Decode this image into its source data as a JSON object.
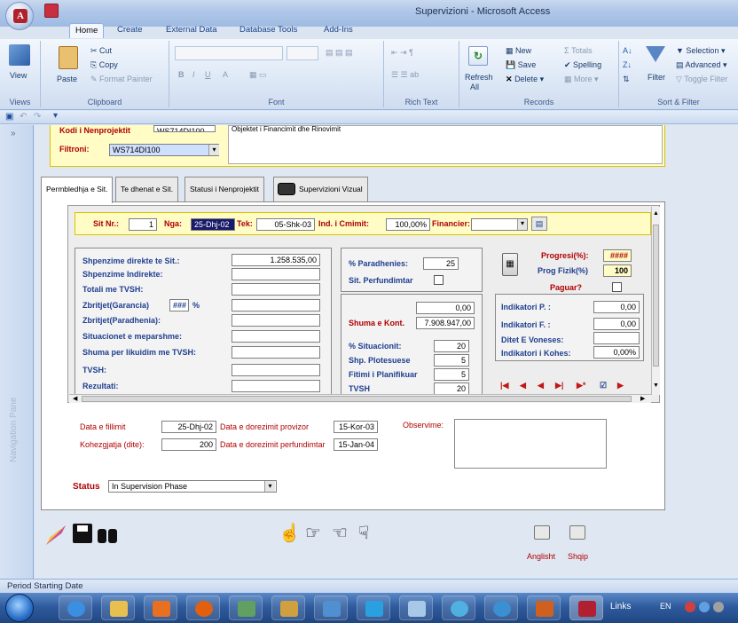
{
  "window": {
    "title": "Supervizioni - Microsoft Access"
  },
  "ribbon_tabs": [
    "Home",
    "Create",
    "External Data",
    "Database Tools",
    "Add-Ins"
  ],
  "ribbon": {
    "views": {
      "label": "View",
      "group": "Views"
    },
    "clipboard": {
      "paste": "Paste",
      "cut": "Cut",
      "copy": "Copy",
      "format_painter": "Format Painter",
      "group": "Clipboard"
    },
    "font": {
      "group": "Font",
      "bold": "B",
      "italic": "I",
      "underline": "U",
      "font_color": "A"
    },
    "rich_text": {
      "group": "Rich Text"
    },
    "records": {
      "refresh": "Refresh",
      "refresh_sub": "All",
      "new": "New",
      "save": "Save",
      "delete": "Delete",
      "totals": "Totals",
      "spelling": "Spelling",
      "more": "More",
      "group": "Records"
    },
    "sort_filter": {
      "filter": "Filter",
      "selection": "Selection",
      "advanced": "Advanced",
      "toggle_filter": "Toggle Filter",
      "group": "Sort & Filter"
    }
  },
  "nav_pane": {
    "label": "Navigation Pane"
  },
  "top_record": {
    "kodi_label": "Kodi i Nenprojektit",
    "kodi_value": "WS714DI100",
    "description": "Objektet i Financimit dhe Rinovimit",
    "filter_label": "Filtroni:",
    "filter_value": "WS714DI100"
  },
  "form_tabs": [
    "Permbledhja e Sit.",
    "Te dhenat e Sit.",
    "Statusi i Nenprojektit",
    "Supervizioni Vizual"
  ],
  "sit_header": {
    "nr_label": "Sit Nr.:",
    "nr_value": "1",
    "nga_label": "Nga:",
    "nga_value": "25-Dhj-02",
    "tek_label": "Tek:",
    "tek_value": "05-Shk-03",
    "ind_label": "Ind. i Cmimit:",
    "ind_value": "100,00%",
    "financier_label": "Financier:",
    "financier_value": ""
  },
  "left_box": {
    "rows": [
      {
        "label": "Shpenzime direkte te Sit.:",
        "value": "1.258.535,00"
      },
      {
        "label": "Shpenzime Indirekte:",
        "value": ""
      },
      {
        "label": "Totali me TVSH:",
        "value": ""
      },
      {
        "label": "Zbritjet(Garancia)",
        "value": "",
        "pct": "###",
        "pct_sign": "%"
      },
      {
        "label": "Zbritjet(Paradhenia):",
        "value": ""
      },
      {
        "label": "Situacionet e meparshme:",
        "value": ""
      },
      {
        "label": "Shuma per likuidim me TVSH:",
        "value": ""
      },
      {
        "label": "TVSH:",
        "value": ""
      },
      {
        "label": "Rezultati:",
        "value": ""
      }
    ]
  },
  "mid_box": {
    "paradhenies_label": "% Paradhenies:",
    "paradhenies_value": "25",
    "perfundimtar_label": "Sit. Perfundimtar",
    "shuma_empty_value": "0,00",
    "shuma_label": "Shuma e Kont.",
    "shuma_value": "7.908.947,00",
    "situacionit_label": "% Situacionit:",
    "situacionit_value": "20",
    "plotesuese_label": "Shp. Plotesuese",
    "plotesuese_value": "5",
    "fitimi_label": "Fitimi i Planifikuar",
    "fitimi_value": "5",
    "tvsh_label": "TVSH",
    "tvsh_value": "20"
  },
  "right_box": {
    "progresi_label": "Progresi(%):",
    "progresi_value": "####",
    "prog_fizik_label": "Prog Fizik(%)",
    "prog_fizik_value": "100",
    "paguar_label": "Paguar?",
    "ind_p_label": "Indikatori P. :",
    "ind_p_value": "0,00",
    "ind_f_label": "Indikatori F. :",
    "ind_f_value": "0,00",
    "ditet_label": "Ditet E Voneses:",
    "ditet_value": "",
    "kohes_label": "Indikatori i Kohes:",
    "kohes_value": "0,00%"
  },
  "record_nav": [
    "|◀",
    "◀",
    "◀",
    "▶|",
    "▶*",
    "☑",
    "▶"
  ],
  "dates": {
    "fillimit_label": "Data e fillimit",
    "fillimit_value": "25-Dhj-02",
    "provizor_label": "Data e dorezimit provizor",
    "provizor_value": "15-Kor-03",
    "kohezgjatja_label": "Kohezgjatja (dite):",
    "kohezgjatja_value": "200",
    "perfundimtar_label": "Data e dorezimit perfundimtar",
    "perfundimtar_value": "15-Jan-04",
    "observime_label": "Observime:"
  },
  "status": {
    "label": "Status",
    "value": "In Supervision Phase"
  },
  "print_buttons": {
    "anglisht": "Anglisht",
    "shqip": "Shqip"
  },
  "statusbar": {
    "text": "Period Starting Date"
  },
  "taskbar": {
    "links": "Links",
    "lang": "EN"
  }
}
